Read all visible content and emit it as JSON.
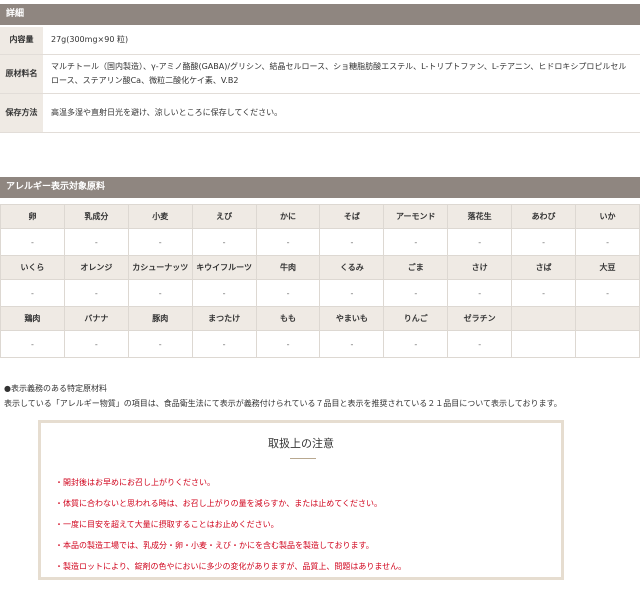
{
  "details": {
    "header": "詳細",
    "rows": [
      {
        "label": "内容量",
        "value": "27g(300mg×90 粒)"
      },
      {
        "label": "原材料名",
        "value": "マルチトール（国内製造）、γ-アミノ酪酸(GABA)/グリシン、結晶セルロース、ショ糖脂肪酸エステル、L-トリプトファン、L-テアニン、ヒドロキシプロピルセルロース、ステアリン酸Ca、微粒二酸化ケイ素、V.B2"
      },
      {
        "label": "保存方法",
        "value": "高温多湿や直射日光を避け、涼しいところに保存してください。"
      }
    ]
  },
  "allergen": {
    "header": "アレルギー表示対象原料",
    "rows": [
      {
        "names": [
          "卵",
          "乳成分",
          "小麦",
          "えび",
          "かに",
          "そば",
          "アーモンド",
          "落花生",
          "あわび",
          "いか"
        ],
        "marks": [
          "-",
          "-",
          "-",
          "-",
          "-",
          "-",
          "-",
          "-",
          "-",
          "-"
        ]
      },
      {
        "names": [
          "いくら",
          "オレンジ",
          "カシューナッツ",
          "キウイフルーツ",
          "牛肉",
          "くるみ",
          "ごま",
          "さけ",
          "さば",
          "大豆"
        ],
        "marks": [
          "-",
          "-",
          "-",
          "-",
          "-",
          "-",
          "-",
          "-",
          "-",
          "-"
        ]
      },
      {
        "names": [
          "鶏肉",
          "バナナ",
          "豚肉",
          "まつたけ",
          "もも",
          "やまいも",
          "りんご",
          "ゼラチン",
          "",
          ""
        ],
        "marks": [
          "-",
          "-",
          "-",
          "-",
          "-",
          "-",
          "-",
          "-",
          "",
          ""
        ]
      }
    ]
  },
  "note": {
    "title": "●表示義務のある特定原材料",
    "text": "表示している「アレルギー物質」の項目は、食品衛生法にて表示が義務付けられている７品目と表示を推奨されている２１品目について表示しております。"
  },
  "caution": {
    "title": "取扱上の注意",
    "items": [
      "・開封後はお早めにお召し上がりください。",
      "・体質に合わないと思われる時は、お召し上がりの量を減らすか、または止めてください。",
      "・一度に目安を超えて大量に摂取することはお止めください。",
      "・本品の製造工場では、乳成分・卵・小麦・えび・かにを含む製品を製造しております。",
      "・製造ロットにより、錠剤の色やにおいに多少の変化がありますが、品質上、問題はありません。"
    ]
  }
}
